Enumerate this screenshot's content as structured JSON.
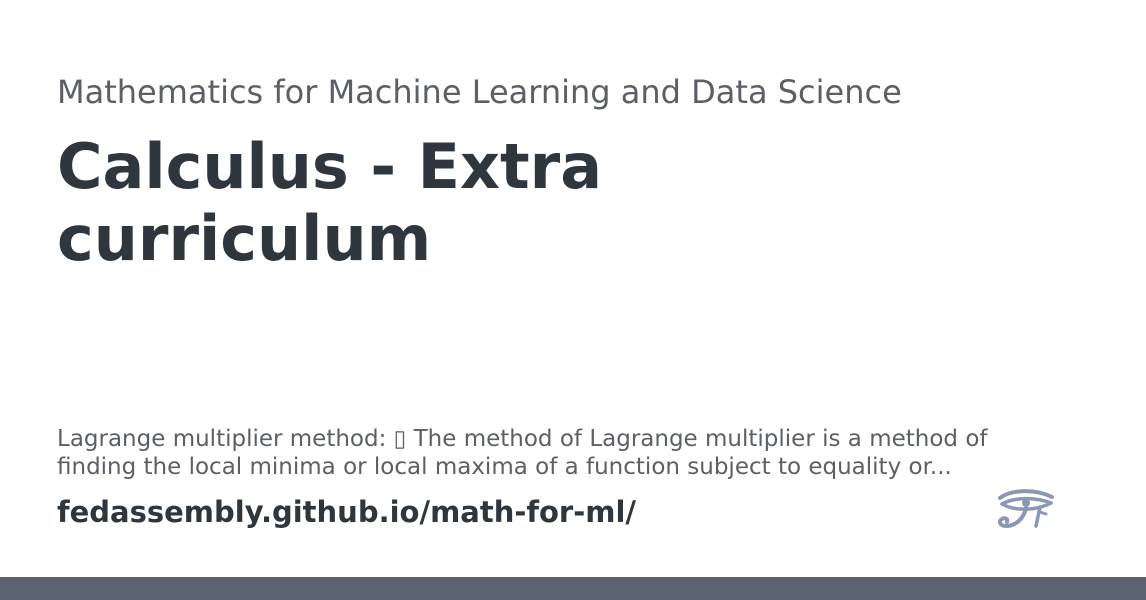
{
  "card": {
    "site_name": "Mathematics for Machine Learning and Data Science",
    "title": "Calculus - Extra curriculum",
    "description": "Lagrange multiplier method: ▯ The method of Lagrange multiplier is a method of finding the local minima or local maxima of a function subject to equality or...",
    "url": "fedassembly.github.io/math-for-ml/",
    "logo_icon": "eye-of-horus-icon"
  },
  "colors": {
    "title": "#2f363d",
    "muted": "#5c6066",
    "logo": "#8b98b4",
    "footer_bar": "#5c6370"
  }
}
